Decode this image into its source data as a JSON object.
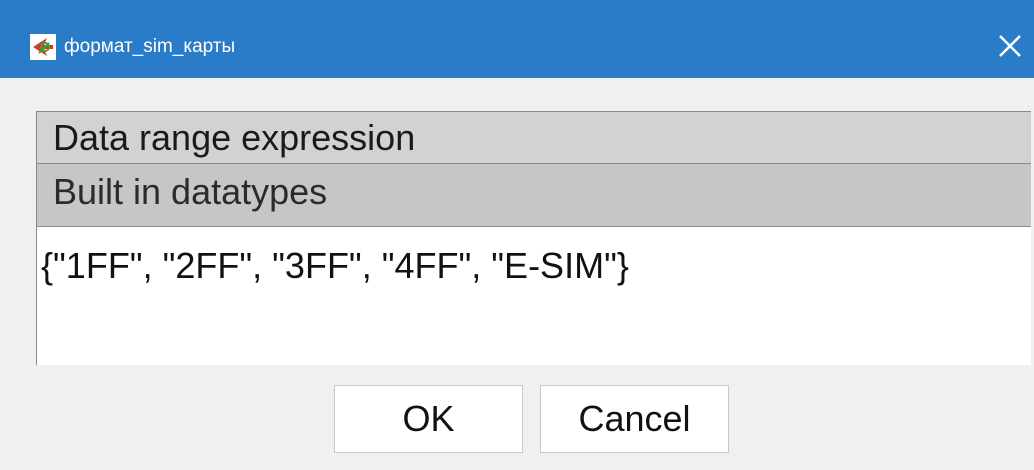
{
  "window": {
    "title": "формат_sim_карты",
    "title_icon": "protege-arrow-icon",
    "close_icon": "close-icon",
    "titlebar_color": "#2a7cc9"
  },
  "tabs": [
    {
      "label": "Data range expression"
    },
    {
      "label": "Built in datatypes"
    }
  ],
  "editor": {
    "value": "{\"1FF\", \"2FF\", \"3FF\", \"4FF\", \"E-SIM\"}"
  },
  "buttons": {
    "ok_label": "OK",
    "cancel_label": "Cancel"
  }
}
